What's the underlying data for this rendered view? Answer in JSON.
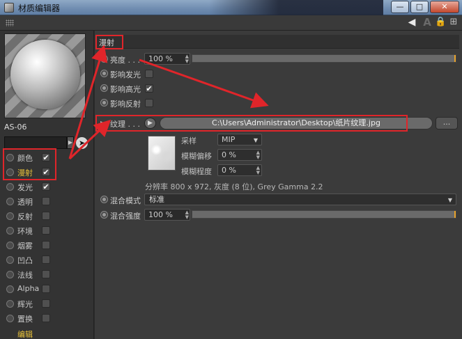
{
  "window": {
    "title": "材质编辑器",
    "controls": {
      "minimize": "—",
      "maximize": "□",
      "close": "✕"
    }
  },
  "toolbar": {
    "icons": [
      "grip-icon",
      "arrow-icon",
      "a-icon",
      "lock-icon",
      "add-icon"
    ]
  },
  "material": {
    "name": "AS-06"
  },
  "channels": [
    {
      "label": "颜色",
      "checked": "✔",
      "selected": false
    },
    {
      "label": "漫射",
      "checked": "✔",
      "selected": true
    },
    {
      "label": "发光",
      "checked": "✔",
      "selected": false
    },
    {
      "label": "透明",
      "checked": "",
      "selected": false
    },
    {
      "label": "反射",
      "checked": "",
      "selected": false
    },
    {
      "label": "环境",
      "checked": "",
      "selected": false
    },
    {
      "label": "烟雾",
      "checked": "",
      "selected": false
    },
    {
      "label": "凹凸",
      "checked": "",
      "selected": false
    },
    {
      "label": "法线",
      "checked": "",
      "selected": false
    },
    {
      "label": "Alpha",
      "checked": "",
      "selected": false
    },
    {
      "label": "辉光",
      "checked": "",
      "selected": false
    },
    {
      "label": "置换",
      "checked": "",
      "selected": false
    }
  ],
  "edit_label": "编辑",
  "section": {
    "title": "漫射"
  },
  "brightness": {
    "label": "亮度 . . .",
    "value": "100 %"
  },
  "affect_luminance": {
    "label": "影响发光",
    "checked": ""
  },
  "affect_specular": {
    "label": "影响高光",
    "checked": "✔"
  },
  "affect_reflection": {
    "label": "影响反射",
    "checked": ""
  },
  "texture": {
    "label": "纹理 . . .",
    "path": "C:\\Users\\Administrator\\Desktop\\纸片纹理.jpg",
    "more_label": "...",
    "sampling_label": "采样",
    "sampling_value": "MIP",
    "blur_offset_label": "模糊偏移",
    "blur_offset_value": "0 %",
    "blur_scale_label": "模糊程度",
    "blur_scale_value": "0 %",
    "info": "分辨率 800 x 972, 灰度 (8 位), Grey Gamma 2.2"
  },
  "blend_mode": {
    "label": "混合模式",
    "value": "标准"
  },
  "blend_strength": {
    "label": "混合强度",
    "value": "100 %"
  },
  "colors": {
    "accent_slider": "#e8a22a",
    "selected_channel": "#e8c23a",
    "annotation": "#e0252a"
  }
}
